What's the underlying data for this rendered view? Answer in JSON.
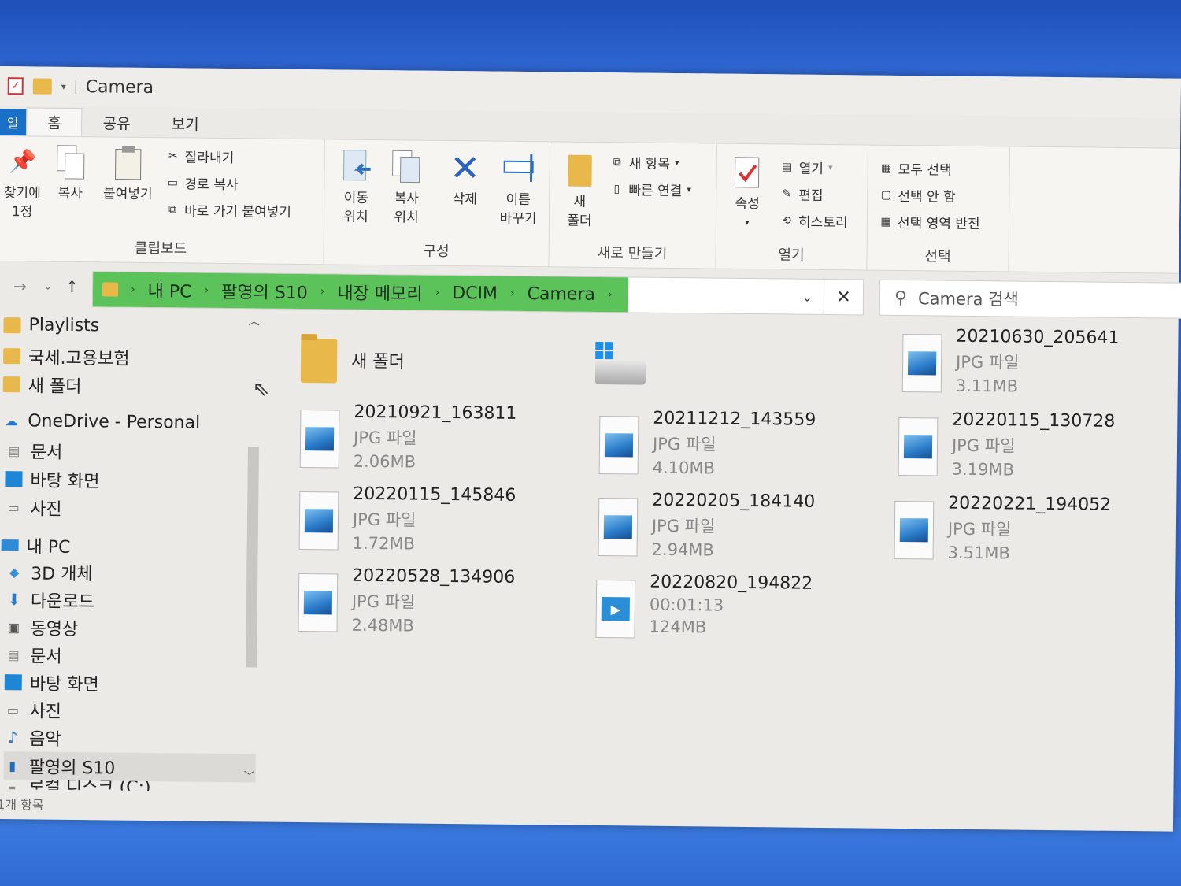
{
  "window": {
    "title": "Camera"
  },
  "tabs": {
    "file": "일",
    "home": "홈",
    "share": "공유",
    "view": "보기"
  },
  "ribbon": {
    "clipboard": {
      "label": "클립보드",
      "pin": "찾기에\n1정",
      "copy": "복사",
      "paste": "붙여넣기",
      "cut": "잘라내기",
      "copy_path": "경로 복사",
      "paste_shortcut": "바로 가기 붙여넣기"
    },
    "organize": {
      "label": "구성",
      "move_to": "이동\n위치",
      "copy_to": "복사\n위치",
      "delete": "삭제",
      "rename": "이름\n바꾸기"
    },
    "new": {
      "label": "새로 만들기",
      "new_folder": "새\n폴더",
      "new_item": "새 항목",
      "easy_access": "빠른 연결"
    },
    "open": {
      "label": "열기",
      "properties": "속성",
      "open": "열기",
      "edit": "편집",
      "history": "히스토리"
    },
    "select": {
      "label": "선택",
      "select_all": "모두 선택",
      "select_none": "선택 안 함",
      "invert": "선택 영역 반전"
    }
  },
  "address": {
    "crumbs": [
      "내 PC",
      "팔영의 S10",
      "내장 메모리",
      "DCIM",
      "Camera"
    ]
  },
  "search": {
    "placeholder": "Camera 검색"
  },
  "sidebar": {
    "items": [
      {
        "label": "Playlists",
        "icon": "folder-icon"
      },
      {
        "label": "국세.고용보험",
        "icon": "folder-icon"
      },
      {
        "label": "새 폴더",
        "icon": "folder-icon"
      },
      {
        "label": "OneDrive - Personal",
        "icon": "cloud-icon"
      },
      {
        "label": "문서",
        "icon": "document-icon"
      },
      {
        "label": "바탕 화면",
        "icon": "desktop-icon"
      },
      {
        "label": "사진",
        "icon": "pictures-icon"
      },
      {
        "label": "내 PC",
        "icon": "computer-icon"
      },
      {
        "label": "3D 개체",
        "icon": "cube-icon"
      },
      {
        "label": "다운로드",
        "icon": "download-icon"
      },
      {
        "label": "동영상",
        "icon": "video-icon"
      },
      {
        "label": "문서",
        "icon": "document-icon"
      },
      {
        "label": "바탕 화면",
        "icon": "desktop-icon"
      },
      {
        "label": "사진",
        "icon": "pictures-icon"
      },
      {
        "label": "음악",
        "icon": "music-icon"
      },
      {
        "label": "팔영의 S10",
        "icon": "phone-icon"
      },
      {
        "label": "로컬 디스크 (C:)",
        "icon": "drive-icon"
      }
    ]
  },
  "files": {
    "new_folder": "새 폴더",
    "items": [
      {
        "name": "20210630_205641",
        "type": "JPG 파일",
        "size": "3.11MB"
      },
      {
        "name": "20210921_163811",
        "type": "JPG 파일",
        "size": "2.06MB"
      },
      {
        "name": "20211212_143559",
        "type": "JPG 파일",
        "size": "4.10MB"
      },
      {
        "name": "20220115_130728",
        "type": "JPG 파일",
        "size": "3.19MB"
      },
      {
        "name": "20220115_145846",
        "type": "JPG 파일",
        "size": "1.72MB"
      },
      {
        "name": "20220205_184140",
        "type": "JPG 파일",
        "size": "2.94MB"
      },
      {
        "name": "20220221_194052",
        "type": "JPG 파일",
        "size": "3.51MB"
      },
      {
        "name": "20220528_134906",
        "type": "JPG 파일",
        "size": "2.48MB"
      },
      {
        "name": "20220820_194822",
        "type": "00:01:13",
        "size": "124MB"
      }
    ]
  },
  "status": {
    "count": "1개 항목"
  }
}
